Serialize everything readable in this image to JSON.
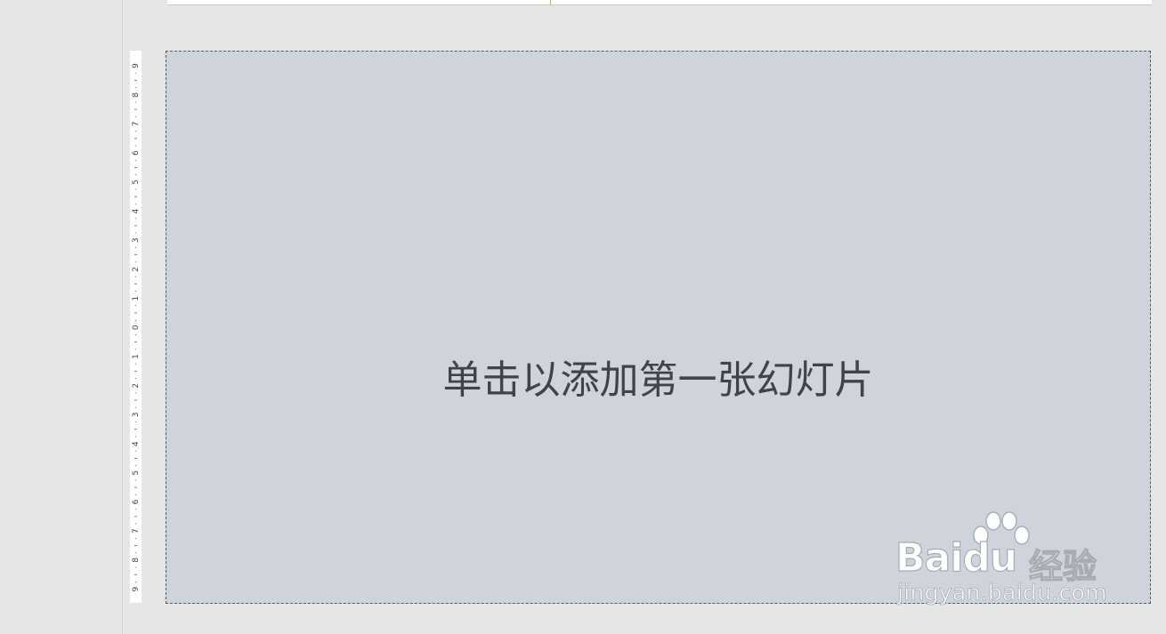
{
  "slide": {
    "placeholder_prompt": "单击以添加第一张幻灯片",
    "background_color": "#cfd3dc"
  },
  "vertical_ruler": {
    "labels": [
      "9",
      "8",
      "7",
      "6",
      "5",
      "4",
      "3",
      "2",
      "1",
      "0",
      "1",
      "2",
      "3",
      "4",
      "5",
      "6",
      "7",
      "8",
      "9"
    ]
  },
  "watermark": {
    "brand": "Bai",
    "brand_suffix": "du",
    "product": "经验",
    "url": "jingyan.baidu.com",
    "icon": "baidu-paw-icon"
  }
}
